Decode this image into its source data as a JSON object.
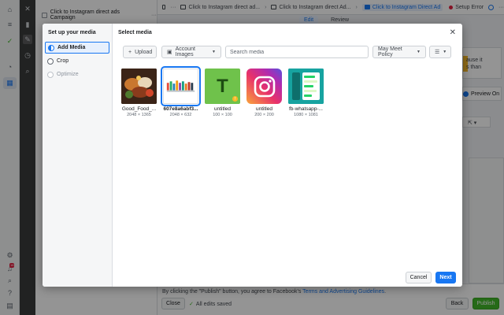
{
  "campaign": {
    "name": "Click to Instagram direct ads Campaign"
  },
  "breadcrumbs": [
    {
      "label": "Click to Instagram direct ad..."
    },
    {
      "label": "Click to Instagram direct Ad..."
    },
    {
      "label": "Click to Instagram Direct Ad"
    }
  ],
  "setup_error": {
    "label": "Setup Error"
  },
  "editor_tabs": [
    {
      "label": "Edit"
    },
    {
      "label": "Review"
    }
  ],
  "background": {
    "cause_text_1": "ause it",
    "cause_text_2": "s than",
    "preview_label": "Preview On"
  },
  "footer": {
    "terms_prefix": "By clicking the \"Publish\" button, you agree to Facebook's ",
    "terms_link": "Terms and Advertising Guidelines",
    "terms_suffix": ".",
    "close_label": "Close",
    "saved_label": "All edits saved",
    "back_label": "Back",
    "publish_label": "Publish"
  },
  "modal": {
    "sidebar_title": "Set up your media",
    "steps": [
      {
        "label": "Add Media"
      },
      {
        "label": "Crop"
      },
      {
        "label": "Optimize"
      }
    ],
    "title": "Select media",
    "toolbar": {
      "upload_label": "Upload",
      "account_images_label": "Account Images",
      "search_placeholder": "Search media",
      "policy_label": "May Meet Policy"
    },
    "media": [
      {
        "name": "Good_Food_...",
        "dims": "2048 × 1365"
      },
      {
        "name": "607e8a6abf3...",
        "dims": "2048 × 632"
      },
      {
        "name": "untitled",
        "dims": "100 × 100",
        "letter": "T"
      },
      {
        "name": "untitled",
        "dims": "200 × 200"
      },
      {
        "name": "fb-whatsapp-...",
        "dims": "1080 × 1081"
      }
    ],
    "cancel_label": "Cancel",
    "next_label": "Next"
  },
  "icons": {
    "home": "home-icon",
    "menu": "menu-icon",
    "chart": "chart-icon",
    "check": "check-icon",
    "gauge": "gauge-icon",
    "table": "table-icon",
    "settings": "gear-icon",
    "bell": "bell-icon",
    "search": "search-icon",
    "help": "help-icon",
    "report": "report-icon"
  },
  "notification_count": "18",
  "colors": {
    "accent": "#1877f2",
    "success": "#42b72a",
    "error": "#e41e3f"
  }
}
